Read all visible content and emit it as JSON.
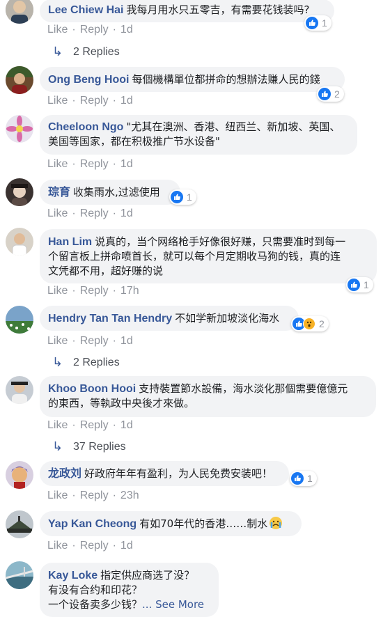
{
  "actions": {
    "like": "Like",
    "reply": "Reply"
  },
  "comments": [
    {
      "name": "Lee Chiew Hai",
      "lines": [
        "我每月用水只五零吉，有需要花钱装吗?"
      ],
      "time": "1d",
      "reactions": "1",
      "replies": "2 Replies"
    },
    {
      "name": "Ong Beng Hooi",
      "lines": [
        "每個機構單位都拼命的想辦法賺人民的錢"
      ],
      "time": "1d",
      "reactions": "2"
    },
    {
      "name": "Cheeloon Ngo",
      "lines": [
        "\"尤其在澳洲、香港、纽西兰、新加坡、英国、",
        "美国等国家，都在积极推广节水设备\""
      ],
      "time": "1d"
    },
    {
      "name": "琮育",
      "lines": [
        "收集雨水,过滤使用"
      ],
      "time": "1d",
      "reactions": "1"
    },
    {
      "name": "Han Lim",
      "lines": [
        "说真的，当个网络枪手好像很好赚，只需要准时到每一",
        "个留言板上拼命喷首长，就可以每个月定期收马狗的钱，真的连",
        "文凭都不用，超好赚的说"
      ],
      "time": "17h",
      "reactions": "1"
    },
    {
      "name": "Hendry Tan Tan Hendry",
      "lines": [
        "不如学新加坡淡化海水"
      ],
      "time": "1d",
      "reactions": "2",
      "replies": "2 Replies"
    },
    {
      "name": "Khoo Boon Hooi",
      "lines": [
        "支持裝置節水設備，海水淡化那個需要億億元",
        "的東西，等執政中央後才來做。"
      ],
      "time": "1d",
      "replies": "37 Replies"
    },
    {
      "name": "龙政刘",
      "lines": [
        "好政府年年有盈利，为人民免费安装吧！"
      ],
      "time": "23h",
      "reactions": "1"
    },
    {
      "name": "Yap Kan Cheong",
      "lines": [
        "有如70年代的香港……制水"
      ],
      "time": "1d"
    },
    {
      "name": "Kay Loke",
      "lines": [
        "指定供应商选了没？",
        "有没有合约和印花？",
        "一个设备卖多少钱？"
      ],
      "see_more": "... See More"
    }
  ]
}
